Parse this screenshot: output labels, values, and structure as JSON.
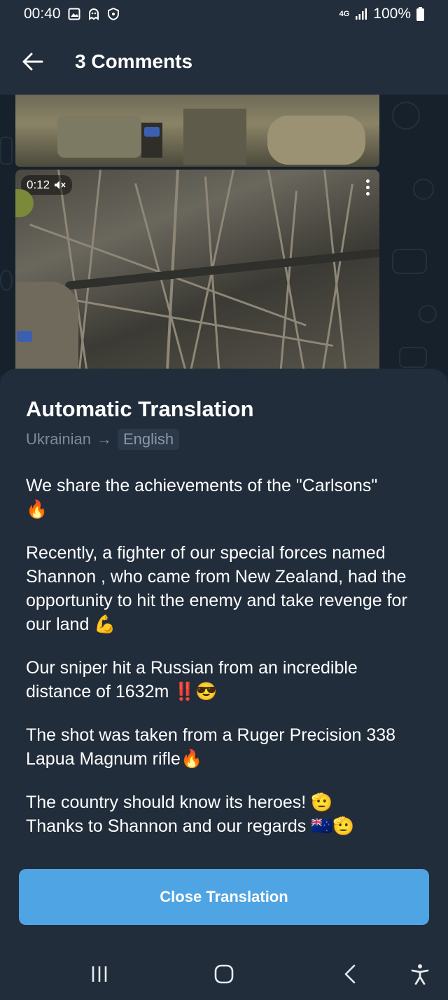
{
  "status_bar": {
    "time": "00:40",
    "network": "4G",
    "battery": "100%",
    "icons": [
      "gallery-icon",
      "ghost-icon",
      "shield-icon",
      "signal-icon",
      "battery-icon"
    ]
  },
  "header": {
    "title": "3 Comments",
    "back_icon": "arrow-left-icon"
  },
  "media": {
    "video_duration": "0:12",
    "muted_icon": "speaker-muted-icon",
    "menu_icon": "more-vertical-icon"
  },
  "translation_sheet": {
    "title": "Automatic Translation",
    "source_language": "Ukrainian",
    "arrow": "→",
    "target_language": "English",
    "paragraphs": [
      "We share the achievements of the \"Carlsons\"\n🔥",
      "Recently, a fighter of our special forces named Shannon , who came from New Zealand, had the opportunity to hit the enemy and take revenge for our land 💪",
      "Our sniper hit a Russian from an incredible distance of 1632m ‼️😎",
      "The shot was taken from a Ruger Precision 338 Lapua Magnum rifle🔥",
      "The country should know its heroes! 🫡\nThanks to Shannon and our regards 🇳🇿🫡"
    ],
    "close_label": "Close Translation"
  },
  "colors": {
    "accent": "#4fa4e3",
    "sheet_bg": "#212d3b",
    "header_bg": "#232e3c",
    "secondary_text": "#7d8b99"
  },
  "navbar": {
    "icons": [
      "recent-apps-icon",
      "home-icon",
      "back-icon",
      "accessibility-icon"
    ]
  }
}
